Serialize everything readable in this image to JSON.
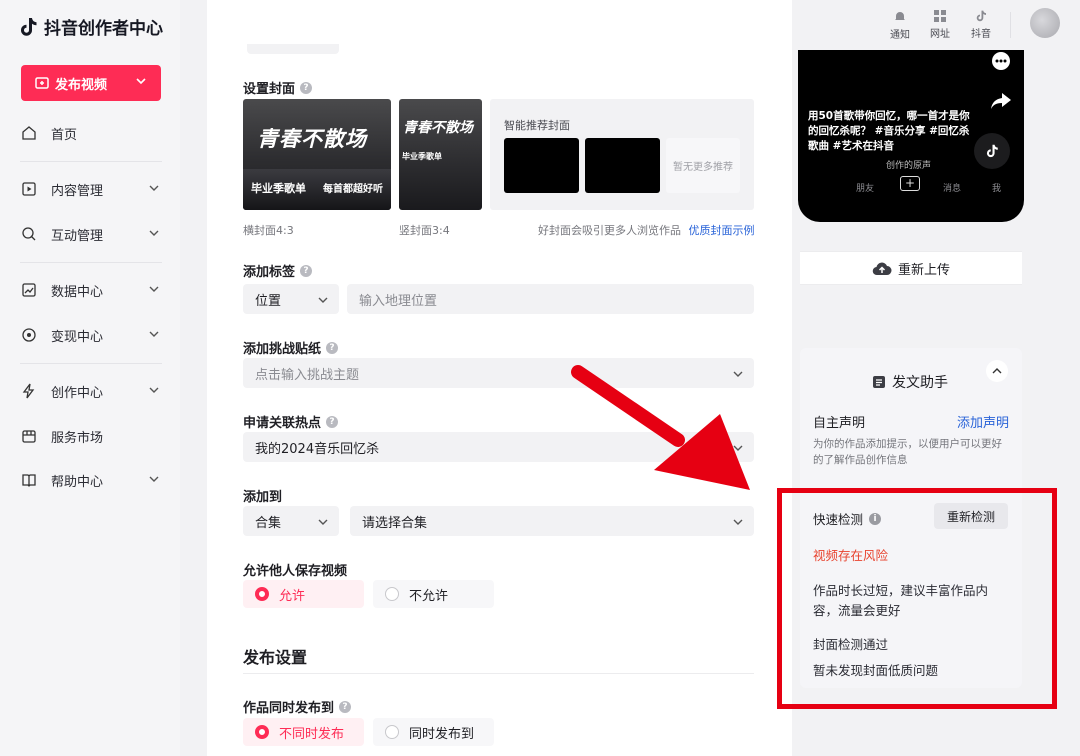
{
  "app": {
    "title": "抖音创作者中心"
  },
  "sidebar": {
    "publish_label": "发布视频",
    "items": [
      {
        "label": "首页",
        "icon": "home-icon"
      },
      {
        "label": "内容管理",
        "icon": "content-icon"
      },
      {
        "label": "互动管理",
        "icon": "interaction-icon"
      },
      {
        "label": "数据中心",
        "icon": "chart-icon"
      },
      {
        "label": "变现中心",
        "icon": "monetize-icon"
      },
      {
        "label": "创作中心",
        "icon": "lightning-icon"
      },
      {
        "label": "服务市场",
        "icon": "market-icon"
      },
      {
        "label": "帮助中心",
        "icon": "book-icon"
      }
    ]
  },
  "topbar": {
    "notify": "通知",
    "url": "网址",
    "douyin": "抖音"
  },
  "cover": {
    "label": "设置封面",
    "landscape_caption": "横封面4:3",
    "portrait_caption": "竖封面3:4",
    "smart_title": "智能推荐封面",
    "no_more": "暂无更多推荐",
    "tip": "好封面会吸引更多人浏览作品",
    "example_link": "优质封面示例",
    "art_title": "青春不散场",
    "art_line1": "毕业季歌单",
    "art_line2": "每首都超好听"
  },
  "tags": {
    "label": "添加标签",
    "select": "位置",
    "placeholder": "输入地理位置"
  },
  "challenge": {
    "label": "添加挑战贴纸",
    "placeholder": "点击输入挑战主题"
  },
  "hotspot": {
    "label": "申请关联热点",
    "value": "我的2024音乐回忆杀"
  },
  "addto": {
    "label": "添加到",
    "select": "合集",
    "placeholder": "请选择合集"
  },
  "save": {
    "label": "允许他人保存视频",
    "allow": "允许",
    "deny": "不允许"
  },
  "publish_settings": {
    "title": "发布设置",
    "sync_label": "作品同时发布到",
    "opt1": "不同时发布",
    "opt2": "同时发布到"
  },
  "preview": {
    "caption": "用50首歌带你回忆，哪一首才是你的回忆杀呢？ #音乐分享 #回忆杀歌曲 #艺术在抖音",
    "music": "创作的原声",
    "tab_friends": "朋友",
    "tab_messages": "消息",
    "tab_me": "我",
    "reupload": "重新上传"
  },
  "assistant": {
    "title": "发文助手",
    "declare_label": "自主声明",
    "declare_link": "添加声明",
    "declare_desc": "为你的作品添加提示，以便用户可以更好的了解作品创作信息",
    "quick_check": "快速检测",
    "recheck": "重新检测",
    "risk": "视频存在风险",
    "risk_desc": "作品时长过短，建议丰富作品内容，流量会更好",
    "cover_pass": "封面检测通过",
    "cover_desc": "暂未发现封面低质问题"
  },
  "colors": {
    "brand": "#fe2c55",
    "link": "#2a64d8",
    "risk": "#e8432e",
    "annotation": "#e60012"
  }
}
